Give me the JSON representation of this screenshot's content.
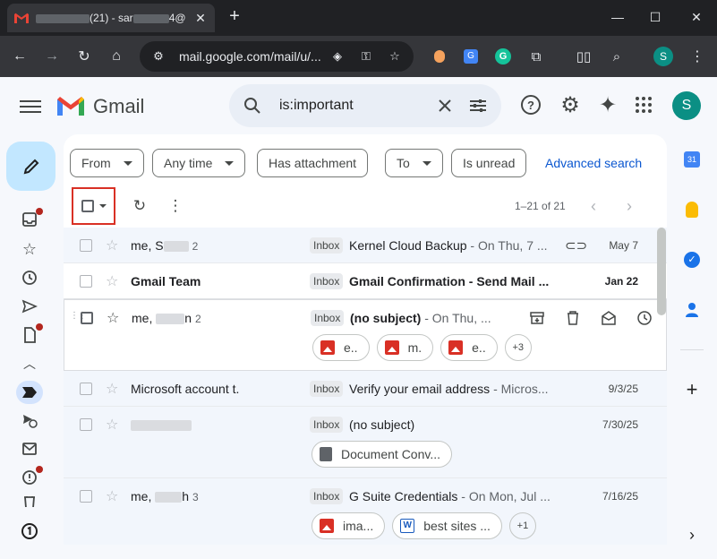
{
  "browser": {
    "tab_title": "(21) - sar",
    "tab_title_suffix": "4@",
    "url": "mail.google.com/mail/u/..."
  },
  "gmail": {
    "brand": "Gmail",
    "search_query": "is:important",
    "avatar_letter": "S",
    "user_avatar_letter": "S"
  },
  "filters": {
    "from": "From",
    "any_time": "Any time",
    "has_attachment": "Has attachment",
    "to": "To",
    "is_unread": "Is unread",
    "advanced_search": "Advanced search"
  },
  "pager": {
    "range": "1–21 of 21"
  },
  "emails": [
    {
      "sender": "me, S",
      "count": "2",
      "label": "Inbox",
      "subject": "Kernel Cloud Backup",
      "snippet": " - On Thu, 7 ...",
      "date": "May 7"
    },
    {
      "sender": "Gmail Team",
      "label": "Inbox",
      "subject": "Gmail Confirmation - Send Mail ...",
      "snippet": "",
      "date": "Jan 22"
    },
    {
      "sender": "me, ",
      "sender_end": "n",
      "count": "2",
      "label": "Inbox",
      "subject": "(no subject)",
      "snippet": " - On Thu, ...",
      "attachments": [
        "e..",
        "m.",
        "e.."
      ],
      "more": "+3"
    },
    {
      "sender": "Microsoft account t.",
      "label": "Inbox",
      "subject": "Verify your email address",
      "snippet": " - Micros...",
      "date": "9/3/25"
    },
    {
      "sender": "",
      "label": "Inbox",
      "subject": "(no subject)",
      "snippet": "",
      "date": "7/30/25",
      "attachments": [
        "Document Conv..."
      ]
    },
    {
      "sender": "me, ",
      "sender_end": "h",
      "count": "3",
      "label": "Inbox",
      "subject": "G Suite Credentials",
      "snippet": " - On Mon, Jul ...",
      "date": "7/16/25",
      "attachments": [
        "ima...",
        "best sites ..."
      ],
      "more": "+1"
    }
  ],
  "colors": {
    "accent": "#0b57d0",
    "compose": "#c2e7ff",
    "avatar": "#0b8f84",
    "highlight": "#d93025"
  }
}
